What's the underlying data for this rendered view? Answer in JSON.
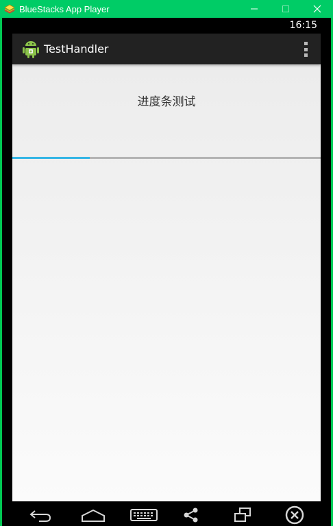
{
  "window": {
    "title": "BlueStacks App Player",
    "icons": {
      "app": "bluestacks-logo",
      "minimize": "minimize-icon",
      "maximize": "maximize-icon",
      "close": "close-icon"
    }
  },
  "status_bar": {
    "time": "16:15"
  },
  "action_bar": {
    "title": "TestHandler",
    "icon": "android-icon",
    "menu_icon": "overflow-menu-icon"
  },
  "content": {
    "label": "进度条测试",
    "progress": {
      "value_percent": 25,
      "color": "#33b5e5",
      "track_color": "#b3b3b3"
    }
  },
  "nav_bar": {
    "icons": [
      "back-icon",
      "home-icon",
      "keyboard-icon",
      "share-icon",
      "multi-window-icon",
      "exit-icon"
    ]
  },
  "colors": {
    "window_chrome": "#00cc66",
    "action_bar": "#222222",
    "progress_accent": "#33b5e5"
  }
}
